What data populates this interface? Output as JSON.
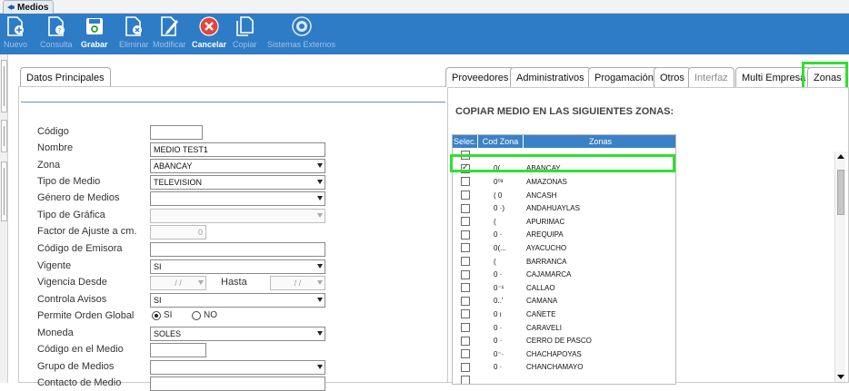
{
  "window": {
    "title": "Medios"
  },
  "toolbar": {
    "buttons": [
      {
        "label": "Nuevo",
        "icon": "new-document-icon",
        "enabled": false
      },
      {
        "label": "Consulta",
        "icon": "query-document-icon",
        "enabled": false
      },
      {
        "label": "Grabar",
        "icon": "save-disk-icon",
        "enabled": true
      },
      {
        "label": "Eliminar",
        "icon": "delete-document-icon",
        "enabled": false
      },
      {
        "label": "Modificar",
        "icon": "edit-pencil-icon",
        "enabled": false
      },
      {
        "label": "Cancelar",
        "icon": "cancel-x-icon",
        "enabled": true
      },
      {
        "label": "Copiar",
        "icon": "copy-document-icon",
        "enabled": false
      },
      {
        "label": "Sistemas Externos",
        "icon": "external-systems-icon",
        "enabled": false
      }
    ]
  },
  "left": {
    "tab_label": "Datos Principales",
    "fields": {
      "codigo": {
        "label": "Código",
        "value": ""
      },
      "nombre": {
        "label": "Nombre",
        "value": "MEDIO TEST1"
      },
      "zona": {
        "label": "Zona",
        "value": "ABANCAY"
      },
      "tipo_medio": {
        "label": "Tipo de Medio",
        "value": "TELEVISION"
      },
      "genero": {
        "label": "Género de Medios",
        "value": ""
      },
      "tipo_grafica": {
        "label": "Tipo de Gráfica",
        "value": ""
      },
      "factor": {
        "label": "Factor de Ajuste a cm.",
        "value": "0"
      },
      "codigo_emisora": {
        "label": "Código de Emisora",
        "value": ""
      },
      "vigente": {
        "label": "Vigente",
        "value": "SI"
      },
      "vigencia_desde": {
        "label": "Vigencia Desde",
        "value": " /  /"
      },
      "hasta": {
        "label": "Hasta",
        "value": " /  /"
      },
      "controla_avisos": {
        "label": "Controla Avisos",
        "value": "SI"
      },
      "orden_global": {
        "label": "Permite Orden Global",
        "option_si": "SI",
        "option_no": "NO",
        "selected": "SI"
      },
      "moneda": {
        "label": "Moneda",
        "value": "SOLES"
      },
      "codigo_medio": {
        "label": "Código en el Medio",
        "value": ""
      },
      "grupo_medios": {
        "label": "Grupo de Medios",
        "value": ""
      },
      "contacto": {
        "label": "Contacto de Medio",
        "value": ""
      }
    }
  },
  "right": {
    "tabs": [
      {
        "label": "Proveedores",
        "enabled": true
      },
      {
        "label": "Administrativos",
        "enabled": true
      },
      {
        "label": "Progamación",
        "enabled": true
      },
      {
        "label": "Otros",
        "enabled": true
      },
      {
        "label": "Interfaz",
        "enabled": false
      },
      {
        "label": "Multi Empresa",
        "enabled": true
      },
      {
        "label": "Zonas",
        "enabled": true,
        "active": true
      }
    ],
    "section_title": "COPIAR MEDIO EN LAS SIGUIENTES ZONAS:",
    "grid": {
      "headers": [
        "Selec.",
        "Cod Zona",
        "Zonas"
      ],
      "rows": [
        {
          "checked": false,
          "code": "",
          "zone": ""
        },
        {
          "checked": true,
          "code": "0(",
          "zone": "ABANCAY"
        },
        {
          "checked": false,
          "code": "0⁰³",
          "zone": "AMAZONAS"
        },
        {
          "checked": false,
          "code": "(  0",
          "zone": "ANCASH"
        },
        {
          "checked": false,
          "code": "0 ·)",
          "zone": "ANDAHUAYLAS"
        },
        {
          "checked": false,
          "code": "(",
          "zone": "APURIMAC"
        },
        {
          "checked": false,
          "code": "0  ·",
          "zone": "AREQUIPA"
        },
        {
          "checked": false,
          "code": "0(...",
          "zone": "AYACUCHO"
        },
        {
          "checked": false,
          "code": "(",
          "zone": "BARRANCA"
        },
        {
          "checked": false,
          "code": "0  ·",
          "zone": "CAJAMARCA"
        },
        {
          "checked": false,
          "code": "0⁻¹",
          "zone": "CALLAO"
        },
        {
          "checked": false,
          "code": "0..'",
          "zone": "CAMANA"
        },
        {
          "checked": false,
          "code": "0  ı",
          "zone": "CAÑETE"
        },
        {
          "checked": false,
          "code": "0  ·",
          "zone": "CARAVELI"
        },
        {
          "checked": false,
          "code": "0  ·",
          "zone": "CERRO DE PASCO"
        },
        {
          "checked": false,
          "code": "0⁻·",
          "zone": "CHACHAPOYAS"
        },
        {
          "checked": false,
          "code": "0  ·",
          "zone": "CHANCHAMAYO"
        },
        {
          "checked": false,
          "code": "",
          "zone": ""
        }
      ]
    }
  },
  "colors": {
    "toolbar": "#2f7cc6",
    "grid_header": "#3a82c8",
    "highlight": "#2ee02e"
  }
}
